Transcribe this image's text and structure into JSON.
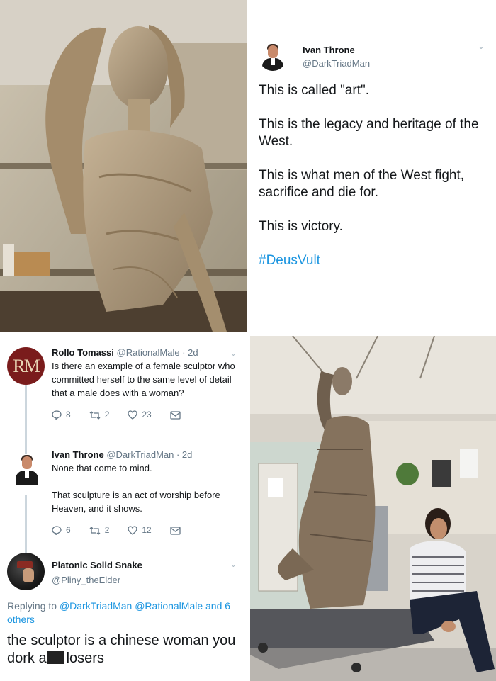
{
  "main_tweet": {
    "name": "Ivan Throne",
    "handle": "@DarkTriadMan",
    "lines": [
      "This is called \"art\".",
      "This is the legacy and heritage of the West.",
      "This is what men of the West fight, sacrifice and die for.",
      "This is victory."
    ],
    "hashtag": "#DeusVult"
  },
  "thread": {
    "reply1": {
      "avatar_text": "RM",
      "name": "Rollo Tomassi",
      "handle_time": "@RationalMale · 2d",
      "text": "Is there an example of a female sculptor who committed herself to the same level of detail that a male does with a woman?",
      "replies": "8",
      "retweets": "2",
      "likes": "23"
    },
    "reply2": {
      "name": "Ivan Throne",
      "handle_time": "@DarkTriadMan · 2d",
      "text1": "None that come to mind.",
      "text2": "That sculpture is an act of worship before Heaven, and it shows.",
      "replies": "6",
      "retweets": "2",
      "likes": "12"
    },
    "reply3": {
      "name": "Platonic Solid Snake",
      "handle": "@Pliny_theElder",
      "replying_prefix": "Replying to",
      "replying_mentions": "@DarkTriadMan @RationalMale and 6 others",
      "text_before": "the sculptor is a chinese woman you dork a",
      "text_after": "losers"
    }
  },
  "colors": {
    "link": "#1b95e0",
    "muted": "#657786",
    "text": "#14171a"
  },
  "icons": [
    "chevron-down-icon",
    "reply-icon",
    "retweet-icon",
    "like-icon",
    "message-icon"
  ]
}
